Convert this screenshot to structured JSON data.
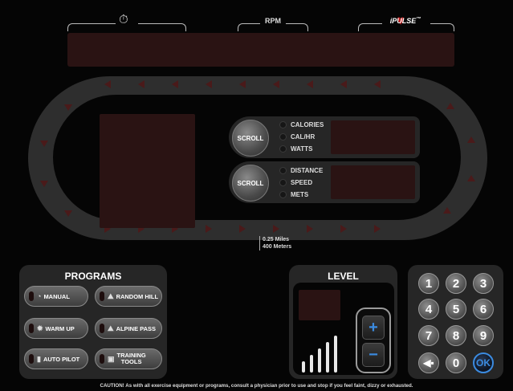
{
  "header": {
    "timer_icon": "stopwatch-icon",
    "rpm_label": "RPM",
    "pulse_label": "iPULSE",
    "pulse_tm": "™",
    "pulse_icon": "heart-icon"
  },
  "scroll_panels": [
    {
      "button_label": "SCROLL",
      "options": [
        "CALORIES",
        "CAL/HR",
        "WATTS"
      ]
    },
    {
      "button_label": "SCROLL",
      "options": [
        "DISTANCE",
        "SPEED",
        "METS"
      ]
    }
  ],
  "track_note": {
    "line1": "0.25 Miles",
    "line2": "400 Meters"
  },
  "programs": {
    "title": "PROGRAMS",
    "buttons": [
      {
        "label": "MANUAL",
        "icon": "gauge-icon"
      },
      {
        "label": "RANDOM HILL",
        "icon": "mountains-icon"
      },
      {
        "label": "WARM UP",
        "icon": "sun-icon"
      },
      {
        "label": "ALPINE PASS",
        "icon": "mountain-pass-icon"
      },
      {
        "label": "AUTO PILOT",
        "icon": "bars-icon"
      },
      {
        "label": "TRAINING",
        "label2": "TOOLS",
        "icon": "toolbox-icon"
      }
    ]
  },
  "level": {
    "title": "LEVEL",
    "plus": "+",
    "minus": "−"
  },
  "keypad": {
    "keys": [
      "1",
      "2",
      "3",
      "4",
      "5",
      "6",
      "7",
      "8",
      "9"
    ],
    "back_icon": "backspace-icon",
    "zero": "0",
    "ok": "OK"
  },
  "caution": "CAUTION! As with all exercise equipment or programs, consult a physician prior to use and stop if you feel faint, dizzy or exhausted.",
  "colors": {
    "display_off": "#2a1313",
    "track": "#2e2e2e",
    "accent_blue": "#3b8be0",
    "arrow": "#4a1a1a"
  }
}
